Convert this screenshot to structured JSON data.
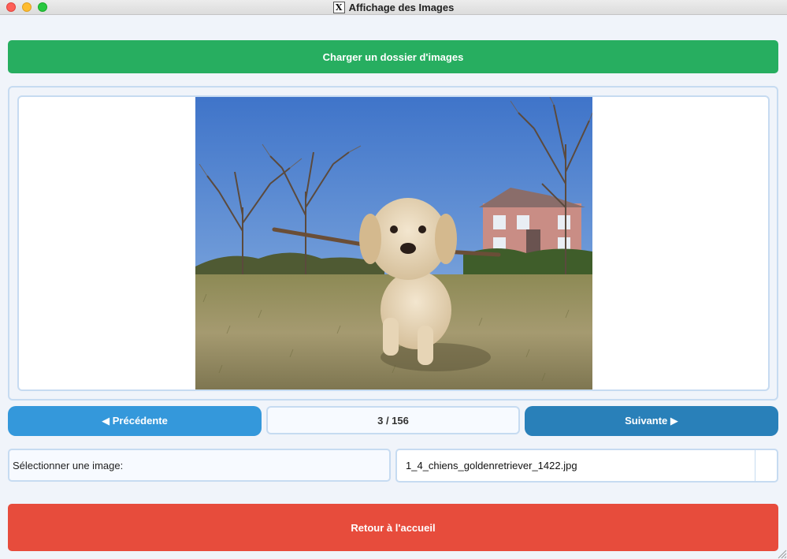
{
  "window": {
    "title": "Affichage des Images"
  },
  "toolbar": {
    "load_label": "Charger un dossier d'images"
  },
  "navigation": {
    "prev_label": "◀ Précédente",
    "next_label": "Suivante ▶",
    "counter": "3 / 156"
  },
  "selector": {
    "label": "Sélectionner une image:",
    "selected": "1_4_chiens_goldenretriever_1422.jpg"
  },
  "footer": {
    "home_label": "Retour à l'accueil"
  },
  "colors": {
    "load_button": "#27ae60",
    "prev_button": "#3498db",
    "next_button": "#2980b9",
    "home_button": "#e74c3c",
    "panel_border": "#c6dbf1",
    "background": "#f0f4fa"
  }
}
